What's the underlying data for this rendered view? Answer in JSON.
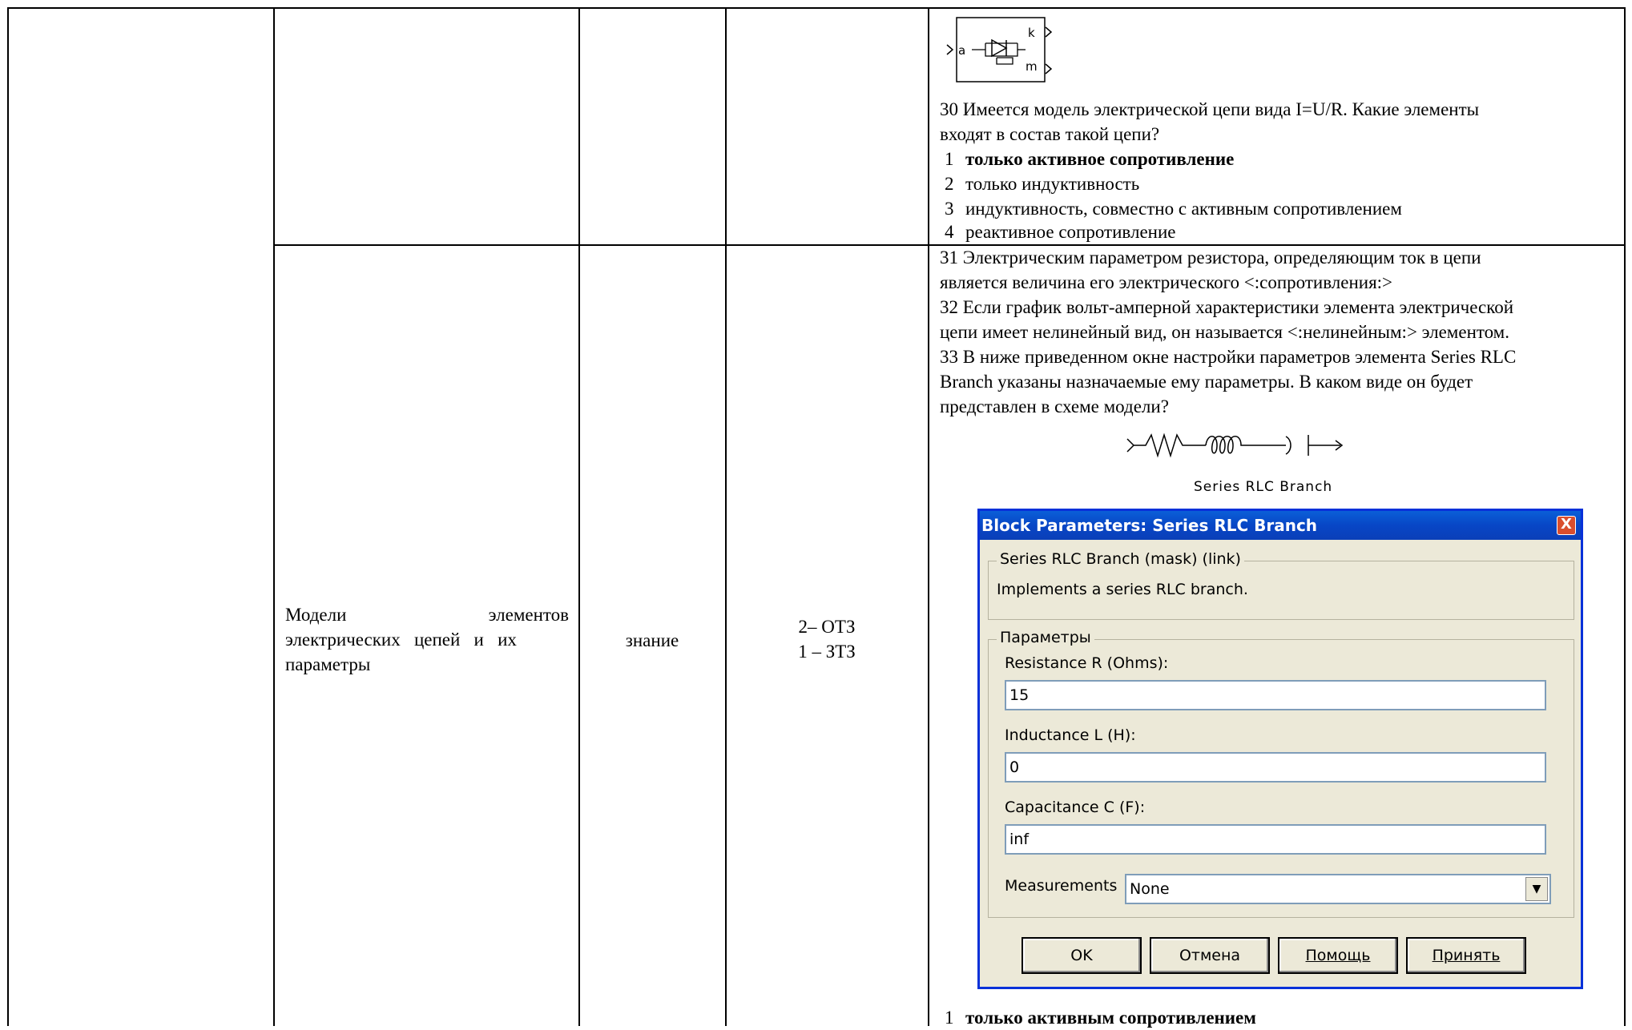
{
  "row1": {
    "q30": {
      "line1": "30 Имеется модель электрической цепи вида I=U/R. Какие элементы",
      "line2": "входят в состав такой цепи?"
    },
    "options": [
      {
        "num": "1",
        "text": "только активное сопротивление"
      },
      {
        "num": "2",
        "text": "только индуктивность"
      },
      {
        "num": "3",
        "text": "индуктивность, совместно с активным сопротивлением"
      },
      {
        "num": "4",
        "text": "реактивное сопротивление"
      }
    ],
    "block_labels": {
      "a": "a",
      "k": "k",
      "m": "m"
    }
  },
  "row2": {
    "topic": {
      "line1_left": "Модели",
      "line1_right": "элементов",
      "line2": "электрических   цепей   и   их",
      "line3": "параметры"
    },
    "type": "знание",
    "tasks": {
      "line1": "2– ОТЗ",
      "line2": "1 – ЗТЗ"
    },
    "q31": {
      "line1": " 31 Электрическим параметром резистора, определяющим ток в цепи",
      "line2": "является величина его электрического <:сопротивления:>"
    },
    "q32": {
      "line1": "32 Если график вольт-амперной характеристики элемента электрической",
      "line2": "цепи имеет нелинейный вид, он называется  <:нелинейным:> элементом."
    },
    "q33": {
      "line1": "33 В ниже приведенном окне настройки параметров элемента Series RLC",
      "line2": "Branch указаны назначаемые ему параметры. В каком виде он будет",
      "line3": "представлен в схеме модели?"
    },
    "rlc_caption": "Series RLC Branch",
    "dialog": {
      "title": "Block Parameters: Series RLC Branch",
      "close_label": "X",
      "mask_group": "Series RLC Branch (mask) (link)",
      "description": "Implements a series RLC branch.",
      "params_group": "Параметры",
      "resistance_label": "Resistance R (Ohms):",
      "resistance_value": "15",
      "inductance_label": "Inductance L (H):",
      "inductance_value": "0",
      "capacitance_label": "Capacitance C (F):",
      "capacitance_value": "inf",
      "measurements_label": "Measurements",
      "measurements_value": "None",
      "buttons": {
        "ok": "OK",
        "cancel": "Отмена",
        "help": "Помощь",
        "apply": "Принять"
      }
    },
    "answer1": {
      "num": "1",
      "text": "только активным сопротивлением"
    }
  }
}
